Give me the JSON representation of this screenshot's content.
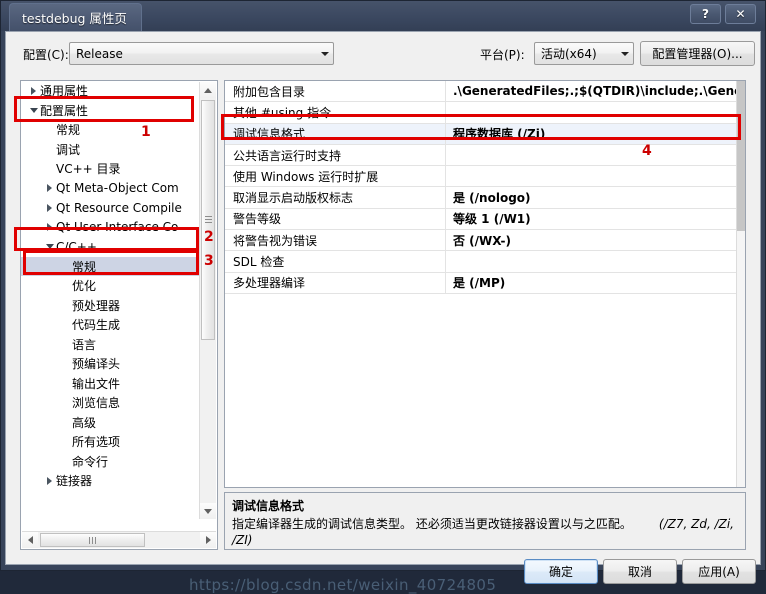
{
  "window": {
    "title": "testdebug 属性页",
    "help_button": "?",
    "close_button": "✕"
  },
  "configbar": {
    "config_label": "配置(C):",
    "config_value": "Release",
    "platform_label": "平台(P):",
    "platform_value": "活动(x64)",
    "config_manager_button": "配置管理器(O)..."
  },
  "tree": {
    "items": [
      {
        "label": "通用属性",
        "indent": 0,
        "expander": "collapsed",
        "selected": false
      },
      {
        "label": "配置属性",
        "indent": 0,
        "expander": "expanded",
        "selected": false
      },
      {
        "label": "常规",
        "indent": 1,
        "expander": "none",
        "selected": false
      },
      {
        "label": "调试",
        "indent": 1,
        "expander": "none",
        "selected": false
      },
      {
        "label": "VC++ 目录",
        "indent": 1,
        "expander": "none",
        "selected": false
      },
      {
        "label": "Qt Meta-Object Com",
        "indent": 1,
        "expander": "collapsed",
        "selected": false
      },
      {
        "label": "Qt Resource Compile",
        "indent": 1,
        "expander": "collapsed",
        "selected": false
      },
      {
        "label": "Qt User Interface Co",
        "indent": 1,
        "expander": "collapsed",
        "selected": false
      },
      {
        "label": "C/C++",
        "indent": 1,
        "expander": "expanded",
        "selected": false
      },
      {
        "label": "常规",
        "indent": 2,
        "expander": "none",
        "selected": true
      },
      {
        "label": "优化",
        "indent": 2,
        "expander": "none",
        "selected": false
      },
      {
        "label": "预处理器",
        "indent": 2,
        "expander": "none",
        "selected": false
      },
      {
        "label": "代码生成",
        "indent": 2,
        "expander": "none",
        "selected": false
      },
      {
        "label": "语言",
        "indent": 2,
        "expander": "none",
        "selected": false
      },
      {
        "label": "预编译头",
        "indent": 2,
        "expander": "none",
        "selected": false
      },
      {
        "label": "输出文件",
        "indent": 2,
        "expander": "none",
        "selected": false
      },
      {
        "label": "浏览信息",
        "indent": 2,
        "expander": "none",
        "selected": false
      },
      {
        "label": "高级",
        "indent": 2,
        "expander": "none",
        "selected": false
      },
      {
        "label": "所有选项",
        "indent": 2,
        "expander": "none",
        "selected": false
      },
      {
        "label": "命令行",
        "indent": 2,
        "expander": "none",
        "selected": false
      },
      {
        "label": "链接器",
        "indent": 1,
        "expander": "collapsed",
        "selected": false
      }
    ]
  },
  "properties": {
    "rows": [
      {
        "name": "附加包含目录",
        "value": ".\\GeneratedFiles;.;$(QTDIR)\\include;.\\GeneratedFi",
        "selected": false
      },
      {
        "name": "其他 #using 指令",
        "value": "",
        "selected": false
      },
      {
        "name": "调试信息格式",
        "value": "程序数据库 (/Zi)",
        "selected": true
      },
      {
        "name": "公共语言运行时支持",
        "value": "",
        "selected": false
      },
      {
        "name": "使用 Windows 运行时扩展",
        "value": "",
        "selected": false
      },
      {
        "name": "取消显示启动版权标志",
        "value": "是 (/nologo)",
        "selected": false
      },
      {
        "name": "警告等级",
        "value": "等级 1 (/W1)",
        "selected": false
      },
      {
        "name": "将警告视为错误",
        "value": "否 (/WX-)",
        "selected": false
      },
      {
        "name": "SDL 检查",
        "value": "",
        "selected": false
      },
      {
        "name": "多处理器编译",
        "value": "是 (/MP)",
        "selected": false
      }
    ]
  },
  "description": {
    "title": "调试信息格式",
    "body": "指定编译器生成的调试信息类型。  还必须适当更改链接器设置以与之匹配。",
    "flags_line1": "(/Z7, Zd, /Zi,",
    "flags_line2": "/ZI)"
  },
  "buttons": {
    "ok": "确定",
    "cancel": "取消",
    "apply": "应用(A)"
  },
  "annotations": {
    "one": "1",
    "two": "2",
    "three": "3",
    "four": "4",
    "accent_color": "#e00000"
  },
  "watermark": {
    "text": "https://blog.csdn.net/weixin_40724805"
  }
}
